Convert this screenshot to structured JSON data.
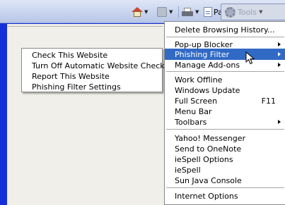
{
  "toolbar": {
    "page_label": "Page",
    "tools_label": "Tools",
    "home_icon": "home-icon",
    "feeds_icon": "feeds-icon",
    "print_icon": "print-icon",
    "page_icon": "page-icon",
    "tools_icon": "gear-icon"
  },
  "tools_menu": {
    "items": [
      {
        "label": "Delete Browsing History..."
      },
      {
        "label": "Pop-up Blocker"
      },
      {
        "label": "Phishing Filter"
      },
      {
        "label": "Manage Add-ons"
      },
      {
        "label": "Work Offline"
      },
      {
        "label": "Windows Update"
      },
      {
        "label": "Full Screen",
        "shortcut": "F11"
      },
      {
        "label": "Menu Bar"
      },
      {
        "label": "Toolbars"
      },
      {
        "label": "Yahoo! Messenger"
      },
      {
        "label": "Send to OneNote"
      },
      {
        "label": "ieSpell Options"
      },
      {
        "label": "ieSpell"
      },
      {
        "label": "Sun Java Console"
      },
      {
        "label": "Internet Options"
      }
    ]
  },
  "phishing_submenu": {
    "items": [
      {
        "label": "Check This Website"
      },
      {
        "label": "Turn Off Automatic Website Checking..."
      },
      {
        "label": "Report This Website"
      },
      {
        "label": "Phishing Filter Settings"
      }
    ]
  },
  "colors": {
    "background": "#1530d8",
    "highlight": "#316ac5",
    "menu_bg": "#ffffff"
  }
}
